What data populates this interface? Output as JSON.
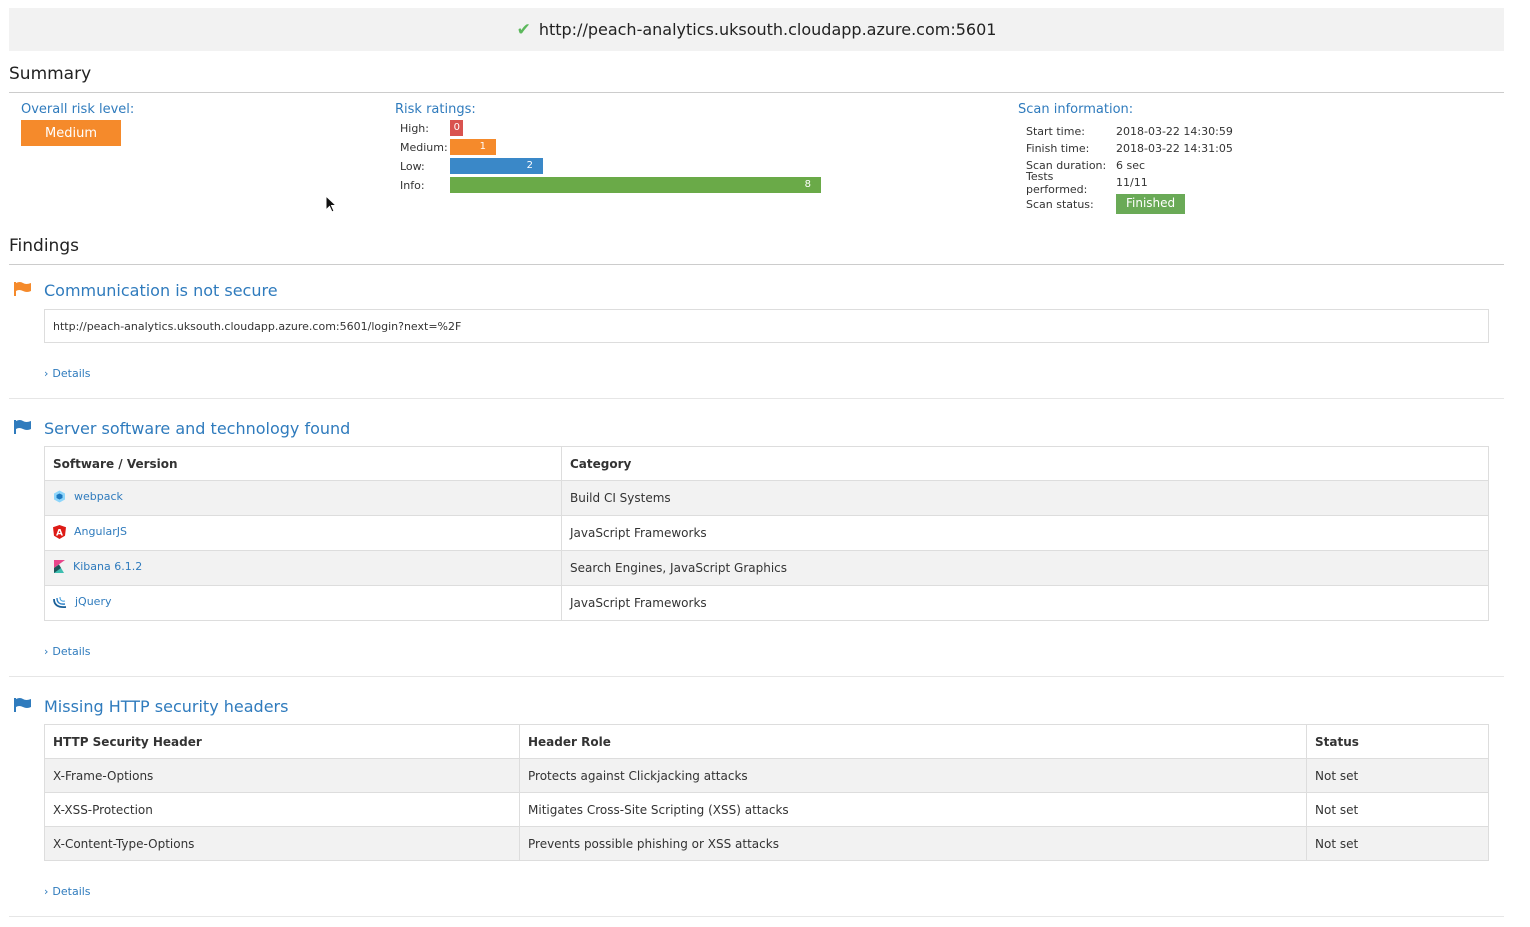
{
  "header": {
    "url": "http://peach-analytics.uksouth.cloudapp.azure.com:5601",
    "status_icon": "check-icon"
  },
  "summary": {
    "title": "Summary",
    "overall_label": "Overall risk level:",
    "overall_value": "Medium",
    "ratings_label": "Risk ratings:",
    "ratings": [
      {
        "label": "High:",
        "value": "0",
        "color": "#d9534f"
      },
      {
        "label": "Medium:",
        "value": "1",
        "color": "#f58a2b"
      },
      {
        "label": "Low:",
        "value": "2",
        "color": "#3a88c8"
      },
      {
        "label": "Info:",
        "value": "8",
        "color": "#6aaa48"
      }
    ],
    "scan_label": "Scan information:",
    "scan": [
      {
        "k": "Start time:",
        "v": "2018-03-22 14:30:59"
      },
      {
        "k": "Finish time:",
        "v": "2018-03-22 14:31:05"
      },
      {
        "k": "Scan duration:",
        "v": "6 sec"
      },
      {
        "k": "Tests performed:",
        "v": "11/11"
      }
    ],
    "scan_status_label": "Scan status:",
    "scan_status": "Finished"
  },
  "findings": {
    "title": "Findings",
    "f1": {
      "title": "Communication is not secure",
      "url": "http://peach-analytics.uksouth.cloudapp.azure.com:5601/login?next=%2F",
      "details": "Details"
    },
    "f2": {
      "title": "Server software and technology found",
      "headers": [
        "Software / Version",
        "Category"
      ],
      "rows": [
        {
          "name": "webpack",
          "icon": "webpack-icon",
          "cat": "Build CI Systems"
        },
        {
          "name": "AngularJS",
          "icon": "angularjs-icon",
          "cat": "JavaScript Frameworks"
        },
        {
          "name": "Kibana 6.1.2",
          "icon": "kibana-icon",
          "cat": "Search Engines, JavaScript Graphics"
        },
        {
          "name": "jQuery",
          "icon": "jquery-icon",
          "cat": "JavaScript Frameworks"
        }
      ],
      "details": "Details"
    },
    "f3": {
      "title": "Missing HTTP security headers",
      "headers": [
        "HTTP Security Header",
        "Header Role",
        "Status"
      ],
      "rows": [
        {
          "h": "X-Frame-Options",
          "r": "Protects against Clickjacking attacks",
          "s": "Not set"
        },
        {
          "h": "X-XSS-Protection",
          "r": "Mitigates Cross-Site Scripting (XSS) attacks",
          "s": "Not set"
        },
        {
          "h": "X-Content-Type-Options",
          "r": "Prevents possible phishing or XSS attacks",
          "s": "Not set"
        }
      ],
      "details": "Details"
    }
  }
}
